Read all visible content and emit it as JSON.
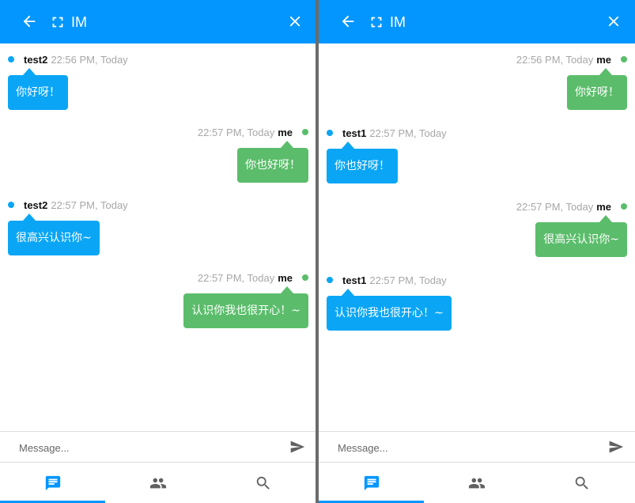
{
  "colors": {
    "header_bg": "#0396ff",
    "incoming_bubble": "#0aa6f5",
    "outgoing_bubble": "#5bbd6b",
    "time_text": "#a7a7a7",
    "nav_active": "#0396ff",
    "nav_inactive": "#616161",
    "divider": "#6b6b6b"
  },
  "icons": {
    "back": "arrow-left-icon",
    "fullscreen": "fullscreen-icon",
    "close": "close-icon",
    "send": "send-icon",
    "chat": "chat-icon",
    "contacts": "people-icon",
    "search": "search-icon"
  },
  "panels": [
    {
      "title": "IM",
      "composer": {
        "placeholder": "Message..."
      },
      "nav": [
        {
          "name": "chat",
          "active": true
        },
        {
          "name": "contacts",
          "active": false
        },
        {
          "name": "search",
          "active": false
        }
      ],
      "messages": [
        {
          "dir": "in",
          "sender": "test2",
          "time": "22:56 PM, Today",
          "text": "你好呀！"
        },
        {
          "dir": "out",
          "sender": "me",
          "time": "22:57 PM, Today",
          "text": "你也好呀！"
        },
        {
          "dir": "in",
          "sender": "test2",
          "time": "22:57 PM, Today",
          "text": "很高兴认识你~"
        },
        {
          "dir": "out",
          "sender": "me",
          "time": "22:57 PM, Today",
          "text": "认识你我也很开心！~"
        }
      ]
    },
    {
      "title": "IM",
      "composer": {
        "placeholder": "Message..."
      },
      "nav": [
        {
          "name": "chat",
          "active": true
        },
        {
          "name": "contacts",
          "active": false
        },
        {
          "name": "search",
          "active": false
        }
      ],
      "messages": [
        {
          "dir": "out",
          "sender": "me",
          "time": "22:56 PM, Today",
          "text": "你好呀！"
        },
        {
          "dir": "in",
          "sender": "test1",
          "time": "22:57 PM, Today",
          "text": "你也好呀！"
        },
        {
          "dir": "out",
          "sender": "me",
          "time": "22:57 PM, Today",
          "text": "很高兴认识你~"
        },
        {
          "dir": "in",
          "sender": "test1",
          "time": "22:57 PM, Today",
          "text": "认识你我也很开心！~"
        }
      ]
    }
  ]
}
